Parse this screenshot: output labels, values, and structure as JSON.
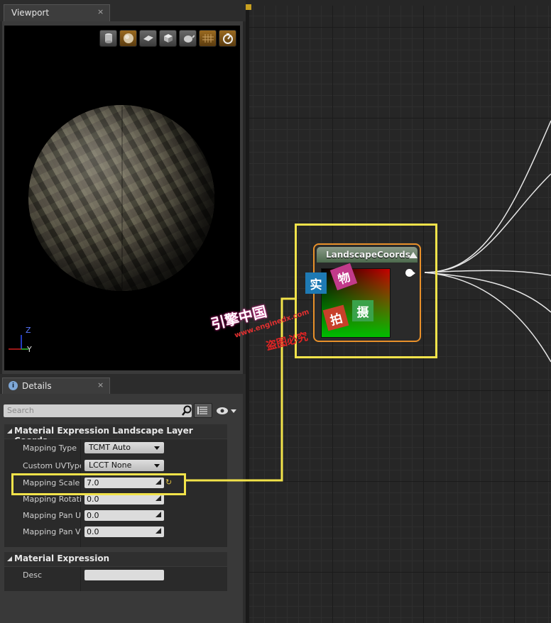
{
  "viewport": {
    "tab_label": "Viewport",
    "close_glyph": "×",
    "toolbar_icons": [
      "cylinder-icon",
      "sphere-icon",
      "plane-icon",
      "cube-icon",
      "teapot-icon",
      "grid-icon",
      "realtime-icon"
    ],
    "axis_labels": {
      "z": "Z",
      "y": "Y"
    }
  },
  "details": {
    "tab_label": "Details",
    "close_glyph": "×",
    "search": {
      "placeholder": "Search",
      "value": ""
    },
    "section1": {
      "title": "Material Expression Landscape Layer Coords",
      "mapping_type_label": "Mapping Type",
      "mapping_type_value": "TCMT Auto",
      "custom_uvtype_label": "Custom UVType",
      "custom_uvtype_value": "LCCT None",
      "mapping_scale_label": "Mapping Scale",
      "mapping_scale_value": "7.0",
      "mapping_rotation_label": "Mapping Rotatic",
      "mapping_rotation_value": "0.0",
      "mapping_pan_u_label": "Mapping Pan U",
      "mapping_pan_u_value": "0.0",
      "mapping_pan_v_label": "Mapping Pan V",
      "mapping_pan_v_value": "0.0"
    },
    "section2": {
      "title": "Material Expression",
      "desc_label": "Desc",
      "desc_value": ""
    }
  },
  "graph": {
    "node_title": "LandscapeCoords"
  },
  "watermark": {
    "chars": [
      "实",
      "物",
      "拍",
      "摄"
    ],
    "line1": "引擎中国",
    "line2": "www.enginedx.com",
    "line3": "盗图必究"
  },
  "colors": {
    "highlight": "#f2e34a",
    "node_border": "#e8902a"
  }
}
